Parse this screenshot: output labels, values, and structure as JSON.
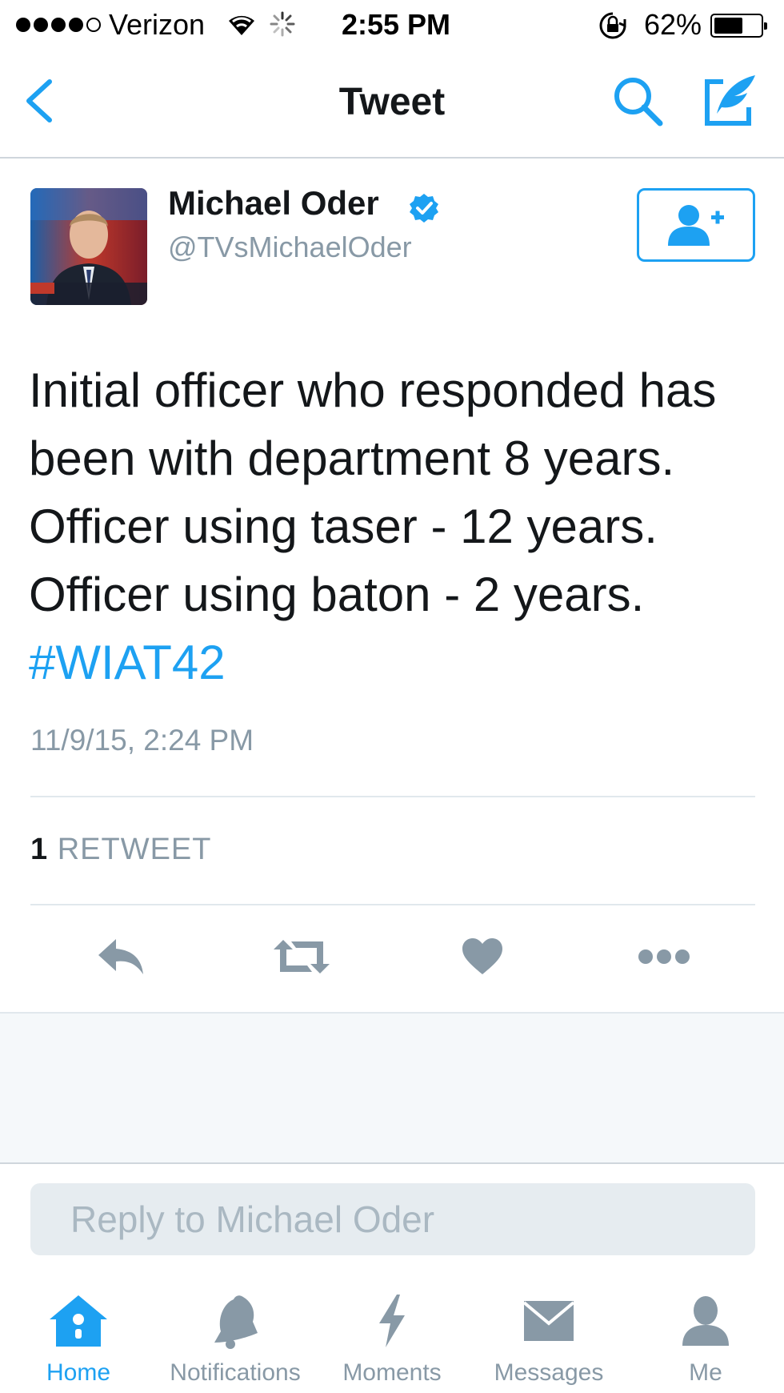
{
  "status_bar": {
    "carrier": "Verizon",
    "time": "2:55 PM",
    "battery_percent": "62%",
    "battery_level": 0.62,
    "signal_icons": [
      "signal-dots-icon",
      "wifi-icon",
      "activity-spinner-icon",
      "rotation-lock-icon",
      "battery-icon"
    ]
  },
  "nav": {
    "title": "Tweet",
    "back_icon": "chevron-left-icon",
    "search_icon": "search-icon",
    "compose_icon": "compose-icon"
  },
  "tweet": {
    "author_name": "Michael Oder",
    "author_handle": "@TVsMichaelOder",
    "verified": true,
    "text_lines": [
      "Initial officer who responded has",
      "been with department 8 years.",
      "Officer using taser - 12 years.",
      "Officer using baton - 2 years."
    ],
    "hashtag": "#WIAT42",
    "timestamp": "11/9/15, 2:24 PM",
    "retweet_count": "1",
    "retweet_label": "RETWEET"
  },
  "reply": {
    "placeholder": "Reply to Michael Oder"
  },
  "tabs": [
    {
      "label": "Home",
      "icon": "home-icon",
      "active": true
    },
    {
      "label": "Notifications",
      "icon": "bell-icon",
      "active": false
    },
    {
      "label": "Moments",
      "icon": "lightning-icon",
      "active": false
    },
    {
      "label": "Messages",
      "icon": "envelope-icon",
      "active": false
    },
    {
      "label": "Me",
      "icon": "person-icon",
      "active": false
    }
  ],
  "colors": {
    "accent": "#1da1f2",
    "text": "#14171a",
    "secondary_text": "#8899a6",
    "action_icon": "#8899a6"
  }
}
